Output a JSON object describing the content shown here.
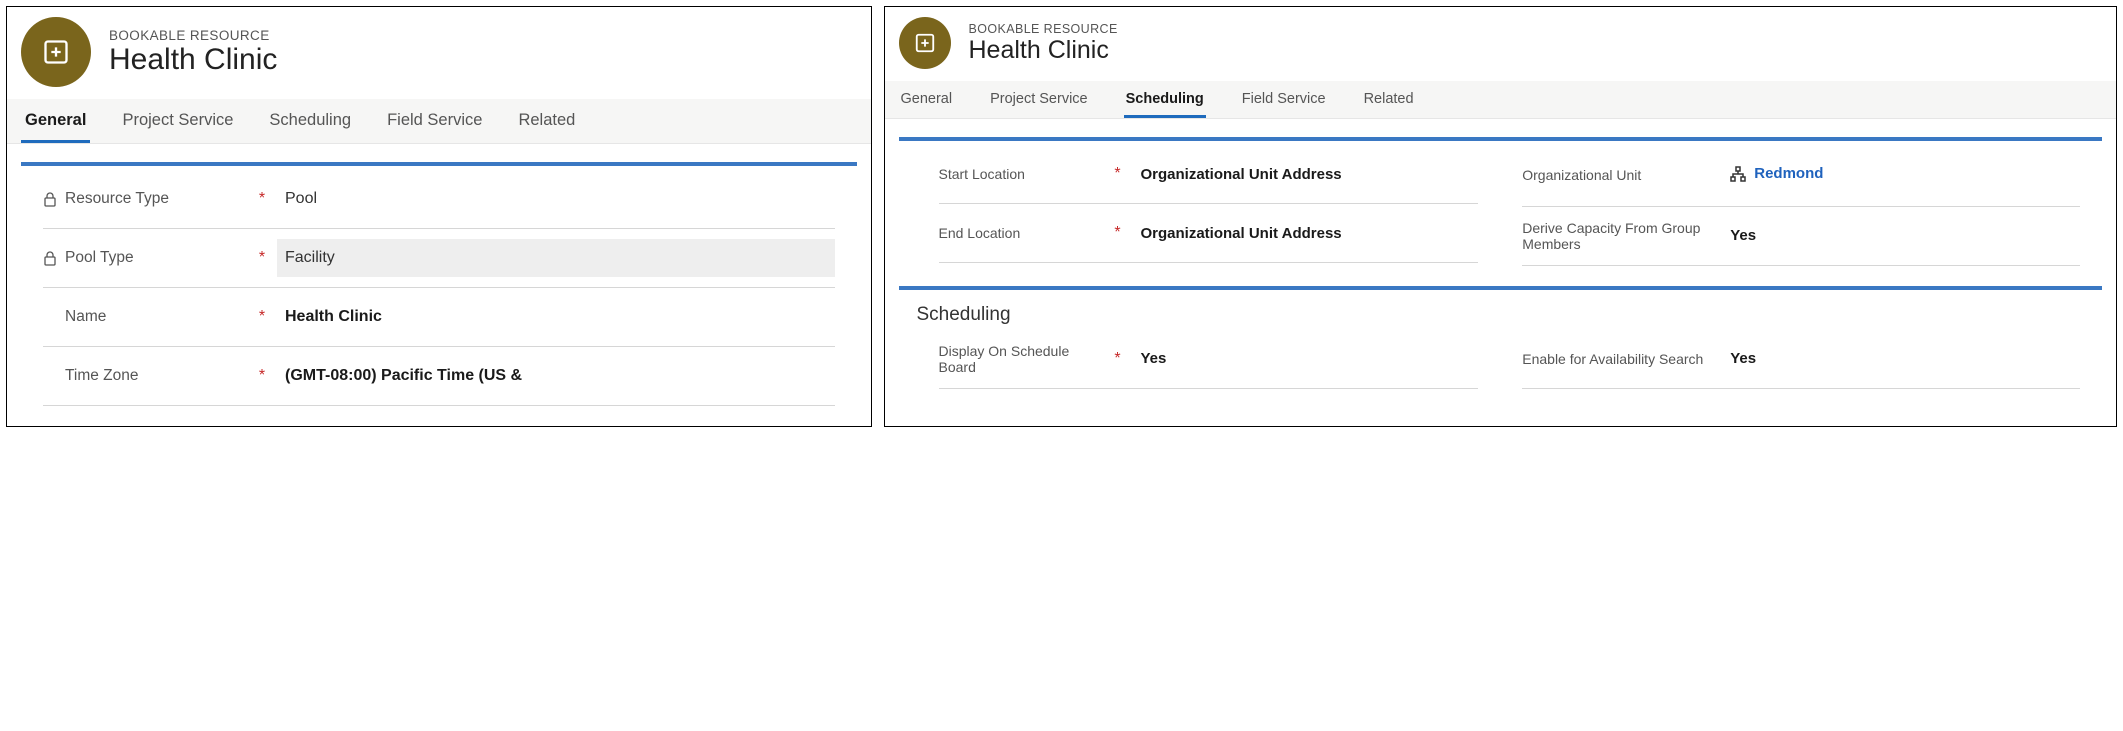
{
  "left": {
    "header": {
      "eyebrow": "BOOKABLE RESOURCE",
      "title": "Health Clinic"
    },
    "tabs": [
      {
        "label": "General",
        "active": true
      },
      {
        "label": "Project Service"
      },
      {
        "label": "Scheduling"
      },
      {
        "label": "Field Service"
      },
      {
        "label": "Related"
      }
    ],
    "fields": {
      "resource_type": {
        "label": "Resource Type",
        "value": "Pool",
        "locked": true,
        "required": true
      },
      "pool_type": {
        "label": "Pool Type",
        "value": "Facility",
        "locked": true,
        "required": true,
        "boxed": true
      },
      "name": {
        "label": "Name",
        "value": "Health Clinic",
        "required": true
      },
      "time_zone": {
        "label": "Time Zone",
        "value": "(GMT-08:00) Pacific Time (US &",
        "required": true
      }
    }
  },
  "right": {
    "header": {
      "eyebrow": "BOOKABLE RESOURCE",
      "title": "Health Clinic"
    },
    "tabs": [
      {
        "label": "General"
      },
      {
        "label": "Project Service"
      },
      {
        "label": "Scheduling",
        "active": true
      },
      {
        "label": "Field Service"
      },
      {
        "label": "Related"
      }
    ],
    "section1": {
      "left_fields": {
        "start_location": {
          "label": "Start Location",
          "value": "Organizational Unit Address",
          "required": true
        },
        "end_location": {
          "label": "End Location",
          "value": "Organizational Unit Address",
          "required": true
        }
      },
      "right_fields": {
        "org_unit": {
          "label": "Organizational Unit",
          "value": "Redmond",
          "link": true
        },
        "derive_capacity": {
          "label": "Derive Capacity From Group Members",
          "value": "Yes"
        }
      }
    },
    "section2": {
      "title": "Scheduling",
      "left_fields": {
        "display_on_board": {
          "label": "Display On Schedule Board",
          "value": "Yes",
          "required": true
        }
      },
      "right_fields": {
        "enable_avail": {
          "label": "Enable for Availability Search",
          "value": "Yes"
        }
      }
    }
  }
}
